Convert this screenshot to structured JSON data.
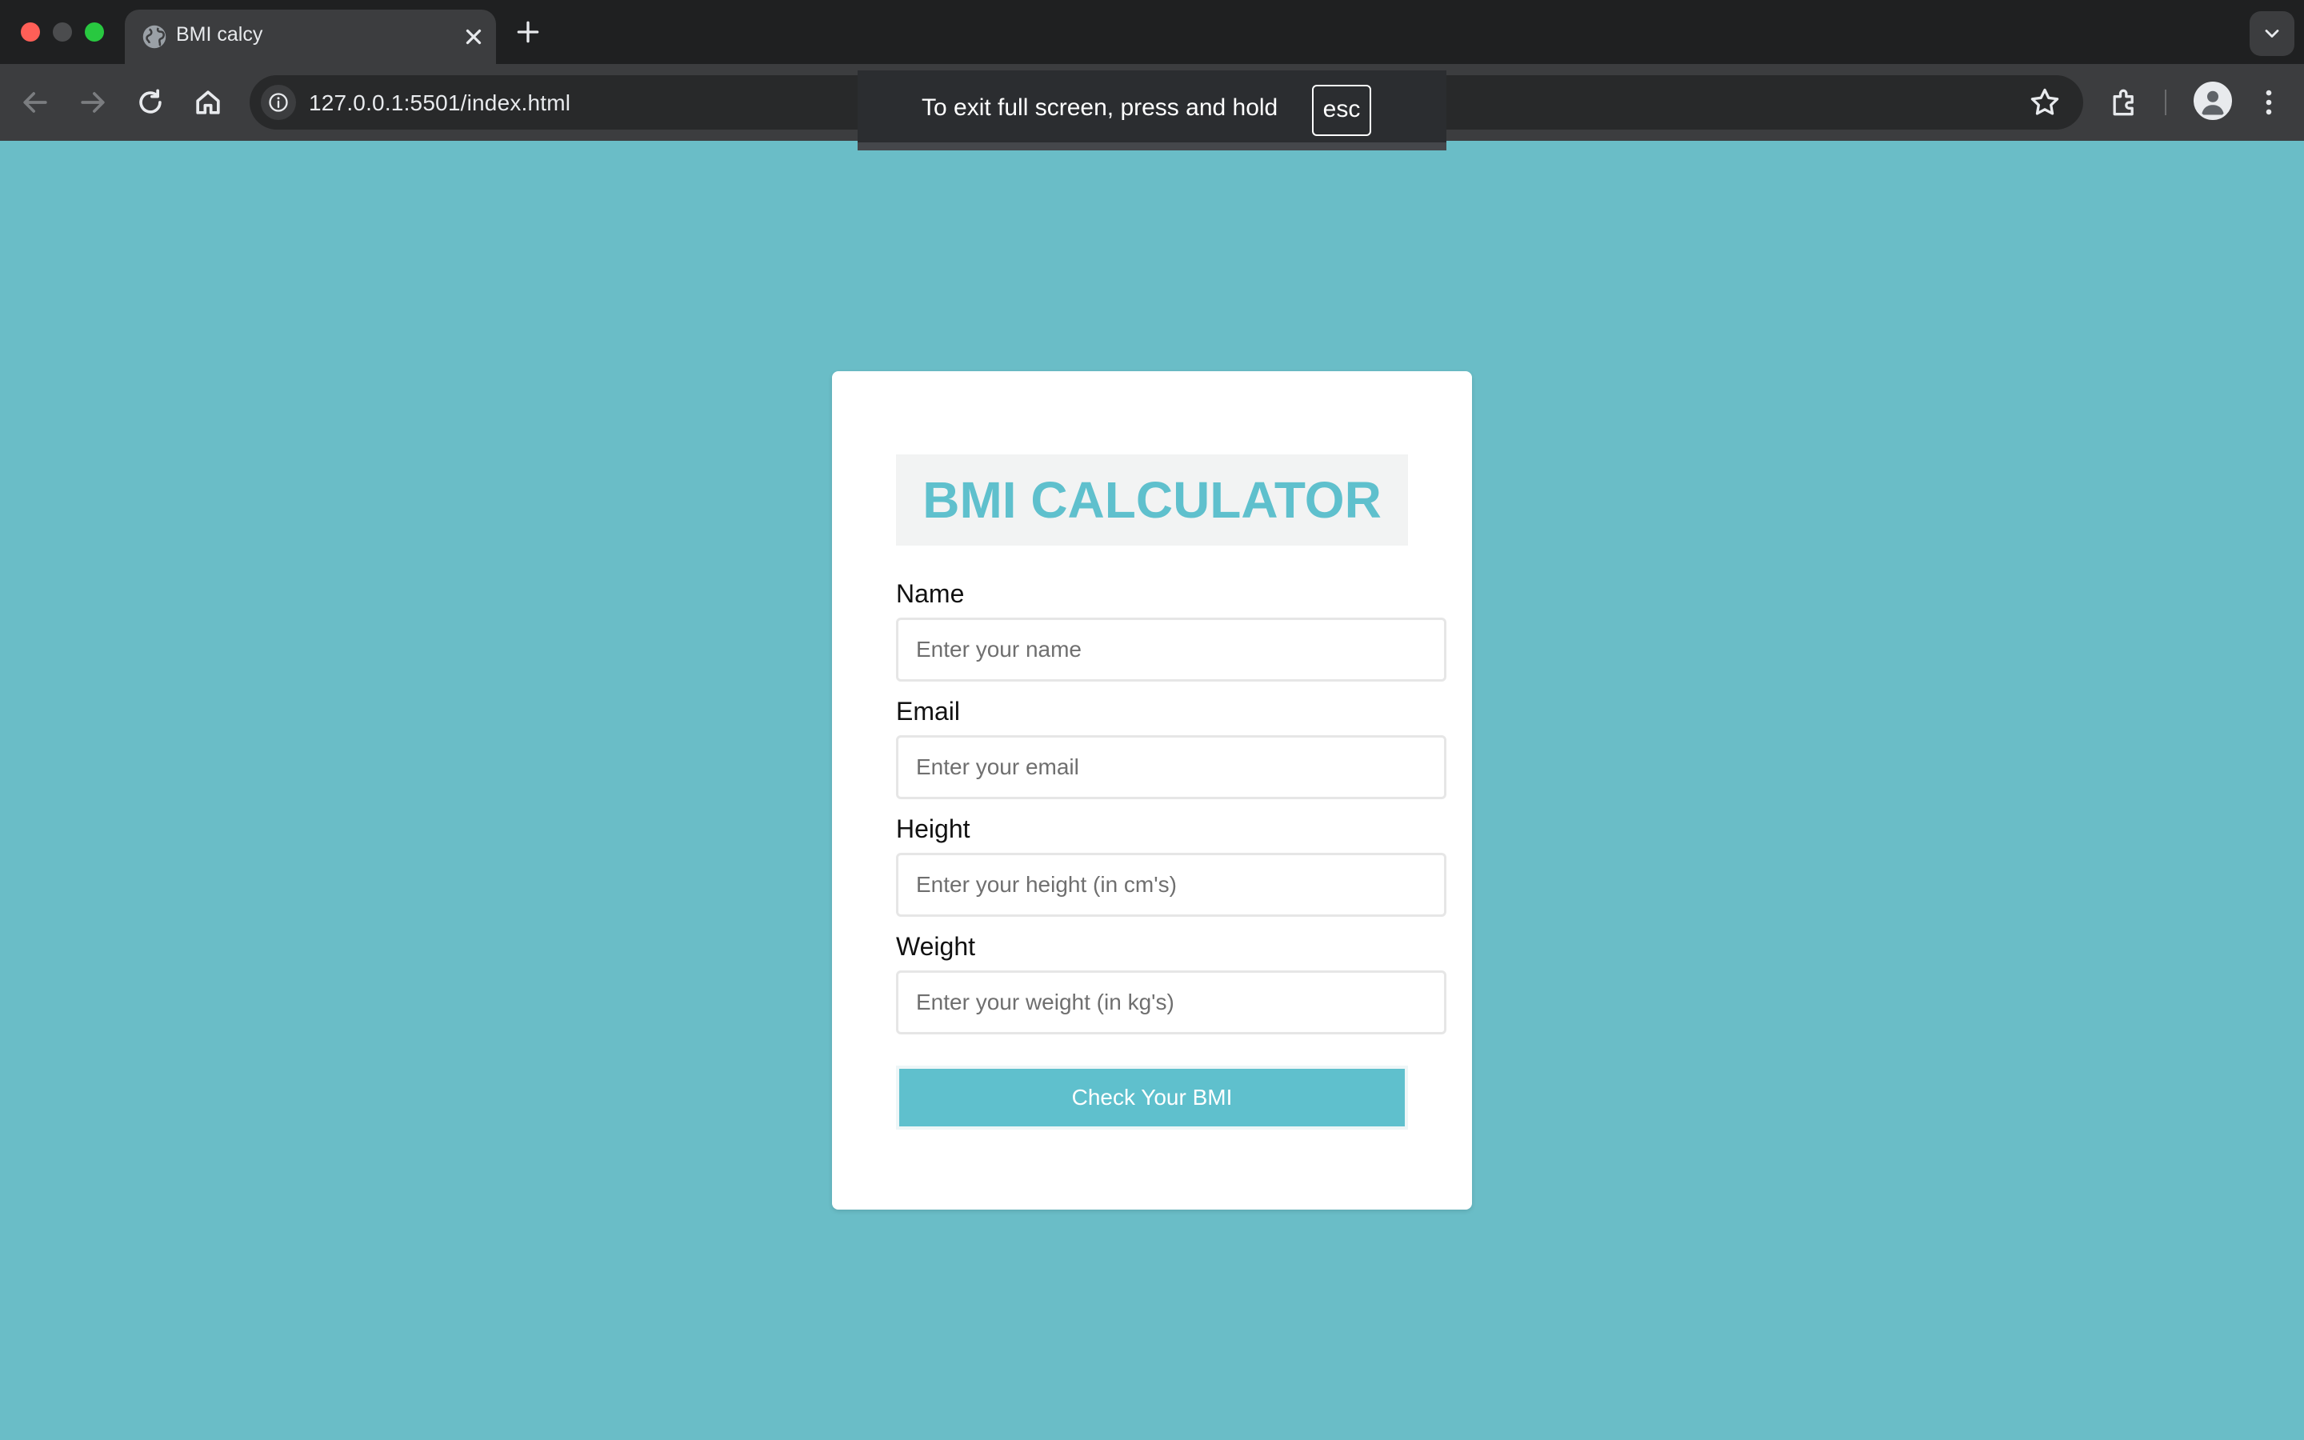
{
  "browser": {
    "tab_title": "BMI calcy",
    "url": "127.0.0.1:5501/index.html",
    "fullscreen_notice": "To exit full screen, press and hold",
    "fullscreen_key": "esc"
  },
  "form": {
    "title": "BMI CALCULATOR",
    "fields": [
      {
        "label": "Name",
        "placeholder": "Enter your name",
        "value": ""
      },
      {
        "label": "Email",
        "placeholder": "Enter your email",
        "value": ""
      },
      {
        "label": "Height",
        "placeholder": "Enter your height (in cm's)",
        "value": ""
      },
      {
        "label": "Weight",
        "placeholder": "Enter your weight (in kg's)",
        "value": ""
      }
    ],
    "submit_label": "Check Your BMI"
  },
  "colors": {
    "page_background": "#6abdc7",
    "accent": "#5fc0cd",
    "card": "#ffffff"
  }
}
